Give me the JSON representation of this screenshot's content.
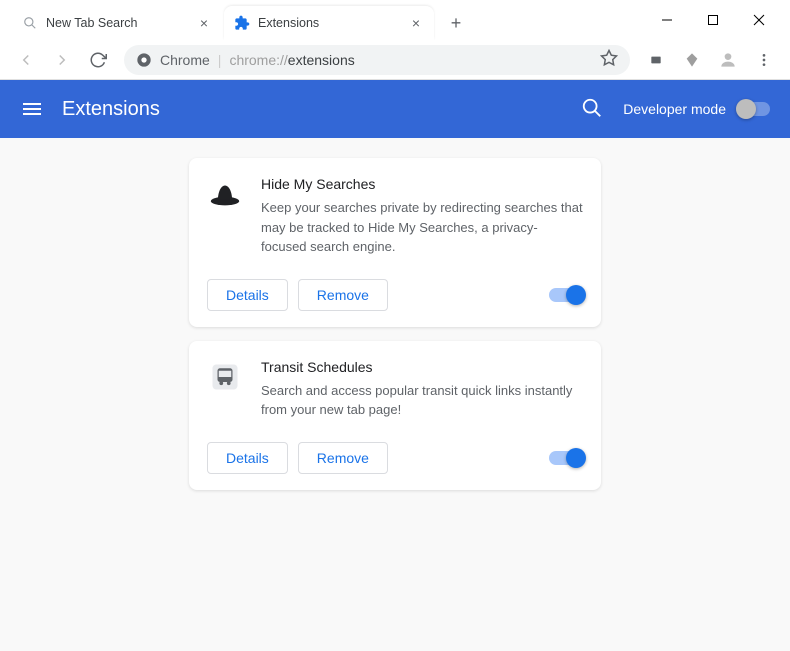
{
  "window": {
    "tabs": [
      {
        "title": "New Tab Search",
        "active": false
      },
      {
        "title": "Extensions",
        "active": true
      }
    ],
    "url_label": "Chrome",
    "url_host": "chrome://",
    "url_path": "extensions"
  },
  "header": {
    "title": "Extensions",
    "dev_mode_label": "Developer mode",
    "dev_mode_on": false
  },
  "extensions": [
    {
      "name": "Hide My Searches",
      "description": "Keep your searches private by redirecting searches that may be tracked to Hide My Searches, a privacy-focused search engine.",
      "enabled": true,
      "icon": "hat"
    },
    {
      "name": "Transit Schedules",
      "description": "Search and access popular transit quick links instantly from your new tab page!",
      "enabled": true,
      "icon": "bus"
    }
  ],
  "buttons": {
    "details": "Details",
    "remove": "Remove"
  }
}
